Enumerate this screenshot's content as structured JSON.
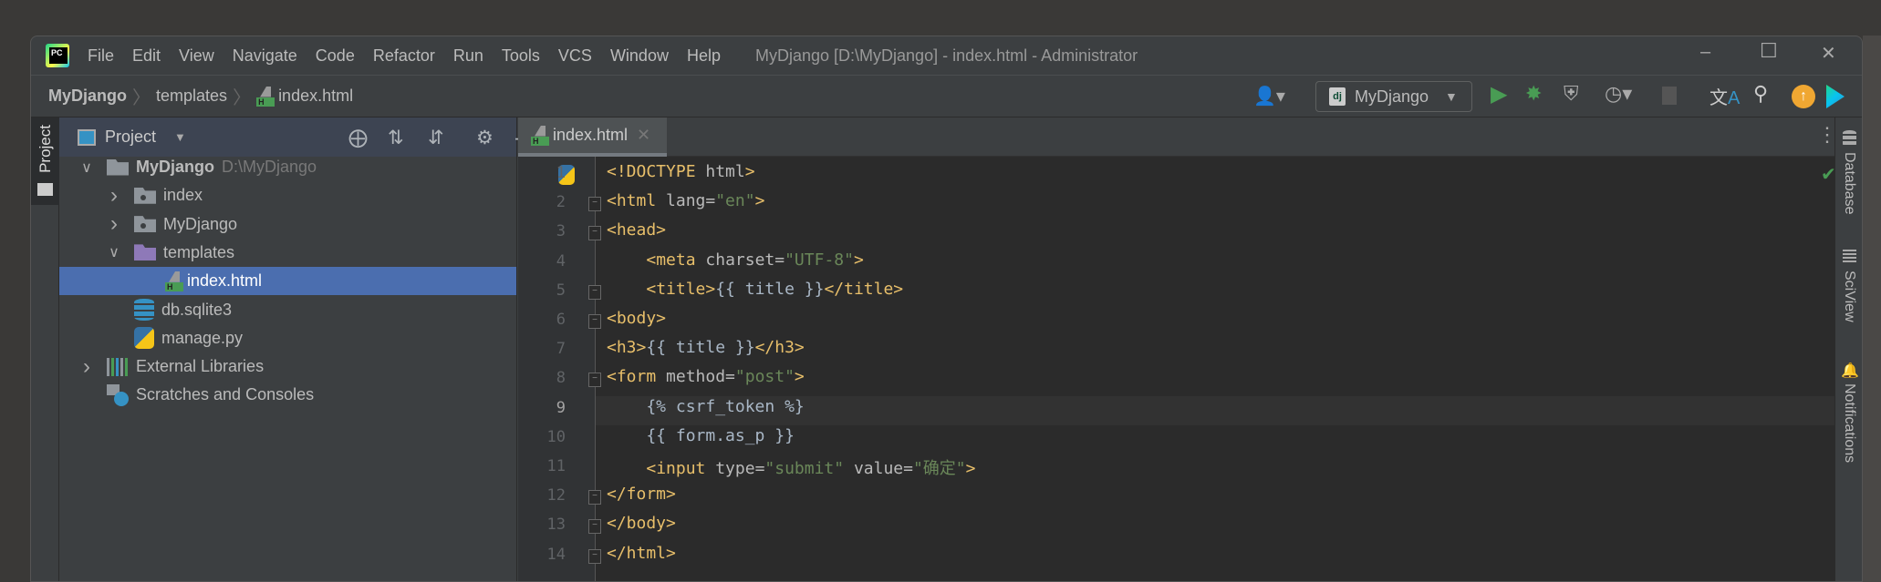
{
  "menubar": {
    "items": [
      "File",
      "Edit",
      "View",
      "Navigate",
      "Code",
      "Refactor",
      "Run",
      "Tools",
      "VCS",
      "Window",
      "Help"
    ],
    "window_title": "MyDjango [D:\\MyDjango] - index.html - Administrator"
  },
  "breadcrumb": [
    "MyDjango",
    "templates",
    "index.html"
  ],
  "toolbar": {
    "run_config": "MyDjango",
    "run_config_badge": "dj"
  },
  "left_stripe": {
    "project": "Project"
  },
  "project_panel": {
    "title": "Project",
    "tree": [
      {
        "label": "MyDjango",
        "hint": "D:\\MyDjango",
        "icon": "folder-icon",
        "expanded": true
      },
      {
        "label": "index",
        "icon": "module-folder-icon",
        "expanded": false
      },
      {
        "label": "MyDjango",
        "icon": "module-folder-icon",
        "expanded": false
      },
      {
        "label": "templates",
        "icon": "templates-folder-icon",
        "expanded": true
      },
      {
        "label": "index.html",
        "icon": "html-file-icon",
        "selected": true
      },
      {
        "label": "db.sqlite3",
        "icon": "database-icon"
      },
      {
        "label": "manage.py",
        "icon": "python-file-icon"
      },
      {
        "label": "External Libraries",
        "icon": "libraries-icon",
        "expanded": false
      },
      {
        "label": "Scratches and Consoles",
        "icon": "scratches-icon"
      }
    ]
  },
  "editor": {
    "tab": "index.html",
    "current_line": 9,
    "lines": [
      [
        [
          "t",
          "<!DOCTYPE "
        ],
        [
          "a",
          "html"
        ],
        [
          "t",
          ">"
        ]
      ],
      [
        [
          "t",
          "<html "
        ],
        [
          "a",
          "lang="
        ],
        [
          "s",
          "\"en\""
        ],
        [
          "t",
          ">"
        ]
      ],
      [
        [
          "t",
          "<head>"
        ]
      ],
      [
        [
          "x",
          "    "
        ],
        [
          "t",
          "<meta "
        ],
        [
          "a",
          "charset="
        ],
        [
          "s",
          "\"UTF-8\""
        ],
        [
          "t",
          ">"
        ]
      ],
      [
        [
          "x",
          "    "
        ],
        [
          "t",
          "<title>"
        ],
        [
          "x",
          "{{ title }}"
        ],
        [
          "t",
          "</title>"
        ]
      ],
      [
        [
          "t",
          "<body>"
        ]
      ],
      [
        [
          "t",
          "<h3>"
        ],
        [
          "x",
          "{{ title }}"
        ],
        [
          "t",
          "</h3>"
        ]
      ],
      [
        [
          "t",
          "<form "
        ],
        [
          "a",
          "method="
        ],
        [
          "s",
          "\"post\""
        ],
        [
          "t",
          ">"
        ]
      ],
      [
        [
          "x",
          "    {% csrf_token %}"
        ]
      ],
      [
        [
          "x",
          "    {{ form.as_p }}"
        ]
      ],
      [
        [
          "x",
          "    "
        ],
        [
          "t",
          "<input "
        ],
        [
          "a",
          "type="
        ],
        [
          "s",
          "\"submit\""
        ],
        [
          "a",
          " value="
        ],
        [
          "s",
          "\"确定\""
        ],
        [
          "t",
          ">"
        ]
      ],
      [
        [
          "t",
          "</form>"
        ]
      ],
      [
        [
          "t",
          "</body>"
        ]
      ],
      [
        [
          "t",
          "</html>"
        ]
      ]
    ]
  },
  "right_stripe": [
    "Database",
    "SciView",
    "Notifications"
  ],
  "colors": {
    "editor_bg": "#2b2b2b",
    "tag": "#e8bf6a",
    "string": "#6a8759",
    "selection": "#4b6eaf",
    "run": "#499c54"
  }
}
